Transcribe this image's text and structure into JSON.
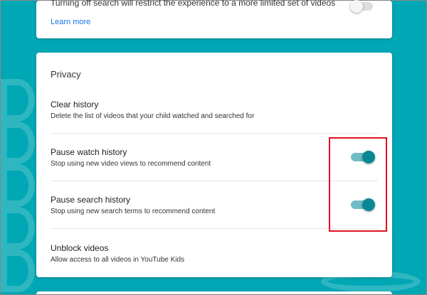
{
  "top_card": {
    "description": "Turning off search will restrict the experience to a more limited set of videos",
    "learn_more": "Learn more",
    "search_toggle_on": false
  },
  "privacy": {
    "title": "Privacy",
    "items": [
      {
        "title": "Clear history",
        "description": "Delete the list of videos that your child watched and searched for"
      },
      {
        "title": "Pause watch history",
        "description": "Stop using new video views to recommend content",
        "toggle_on": true
      },
      {
        "title": "Pause search history",
        "description": "Stop using new search terms to recommend content",
        "toggle_on": true
      },
      {
        "title": "Unblock videos",
        "description": "Allow access to all videos in YouTube Kids"
      }
    ]
  },
  "colors": {
    "background": "#00a7b4",
    "toggle_on": "#0a8795",
    "highlight": "#e01020"
  }
}
